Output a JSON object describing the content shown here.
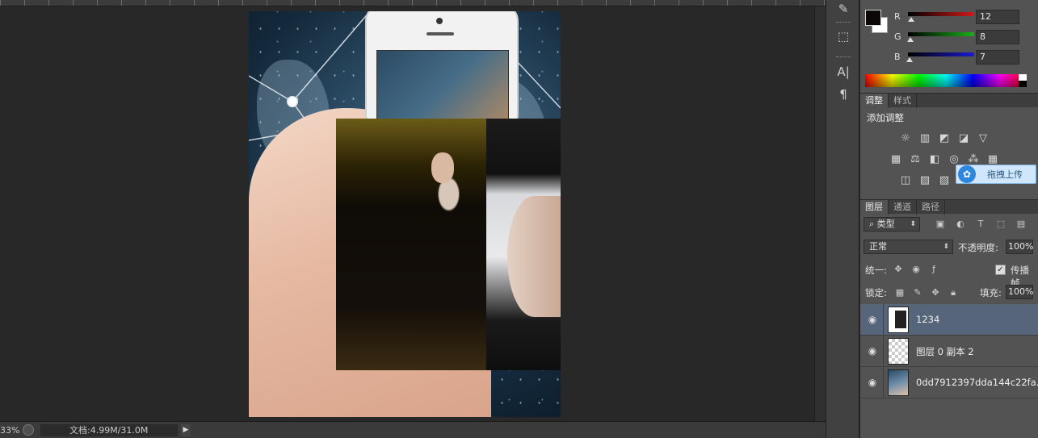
{
  "status_bar": {
    "zoom": "33%",
    "doc_info": "文档:4.99M/31.0M",
    "arrow": "▶"
  },
  "tools": {
    "history_icon": "history-brush-icon",
    "cube_icon": "3d-cube-icon",
    "char_label": "A|",
    "para_label": "¶"
  },
  "color": {
    "foreground": "#0c0807",
    "background": "#ffffff",
    "channels": [
      {
        "label": "R",
        "value": "12",
        "color": "#d01a1a"
      },
      {
        "label": "G",
        "value": "8",
        "color": "#18b018"
      },
      {
        "label": "B",
        "value": "7",
        "color": "#1a1ad0"
      }
    ]
  },
  "adjustments_tabs": [
    {
      "label": "调整",
      "active": true
    },
    {
      "label": "样式",
      "active": false
    }
  ],
  "adjustments": {
    "title": "添加调整",
    "upload_tip": "拖拽上传"
  },
  "layers_tabs": [
    {
      "label": "图层",
      "active": true
    },
    {
      "label": "通道",
      "active": false
    },
    {
      "label": "路径",
      "active": false
    }
  ],
  "layers": {
    "filter_kind": "类型",
    "blend_mode": "正常",
    "opacity_label": "不透明度:",
    "opacity_value": "100%",
    "unify_label": "统一:",
    "propagate_label": "传播帧",
    "lock_label": "锁定:",
    "fill_label": "填充:",
    "fill_value": "100%",
    "items": [
      {
        "name": "1234",
        "selected": true
      },
      {
        "name": "图层 0 副本 2",
        "selected": false
      },
      {
        "name": "0dd7912397dda144c22fa...",
        "selected": false
      }
    ]
  }
}
